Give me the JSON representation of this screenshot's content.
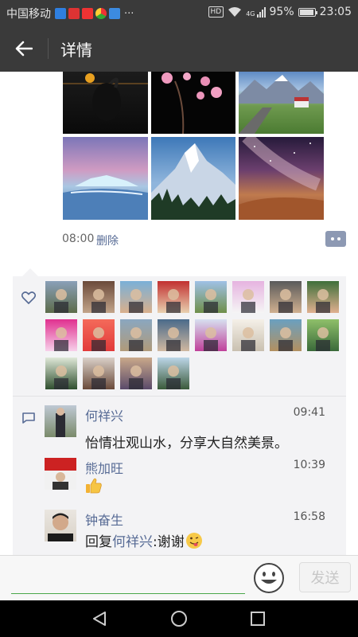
{
  "status_bar": {
    "carrier": "中国移动",
    "more": "···",
    "hd": "HD",
    "signal": "4G",
    "battery": "95%",
    "battery_fraction": 0.95,
    "time": "23:05"
  },
  "header": {
    "title": "详情"
  },
  "post": {
    "time": "08:00",
    "delete_label": "删除"
  },
  "likes": {
    "count": 20
  },
  "comments": [
    {
      "name": "何祥兴",
      "time": "09:41",
      "text": "怡情壮观山水，分享大自然美景。"
    },
    {
      "name": "熊加旺",
      "time": "10:39",
      "emoji": "thumbs-up"
    },
    {
      "name": "钟奋生",
      "time": "16:58",
      "reply_prefix": "回复",
      "reply_to": "何祥兴",
      "text": ":谢谢",
      "emoji": "tongue-wink"
    }
  ],
  "input": {
    "placeholder": "",
    "send_label": "发送"
  },
  "colors": {
    "link": "#576b95",
    "dark_bar": "#3a3a3a",
    "accent_green": "#4aa84a"
  }
}
